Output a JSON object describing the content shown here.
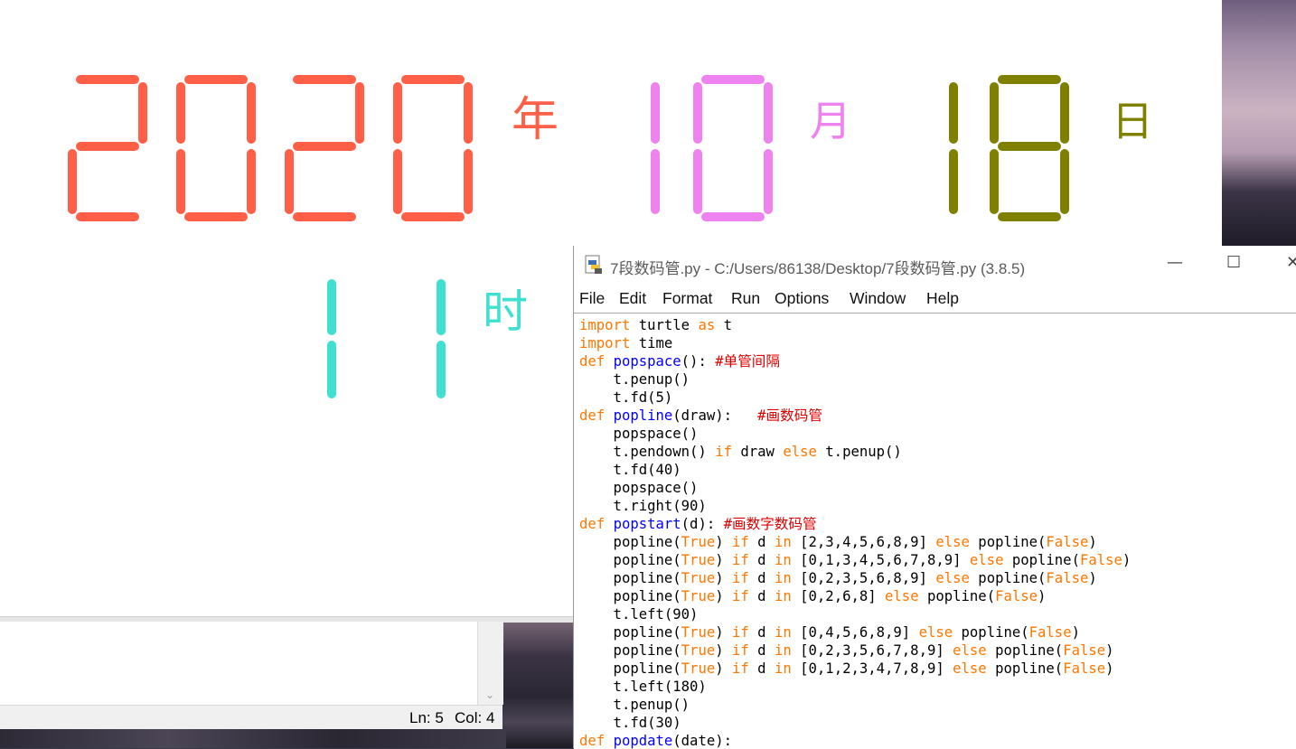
{
  "turtle_display": {
    "year": {
      "digits": "2020",
      "unit": "年",
      "color": "#ff5e47"
    },
    "month": {
      "digits": "10",
      "unit": "月",
      "color": "#ee82ee"
    },
    "day": {
      "digits": "18",
      "unit": "日",
      "color": "#808000"
    },
    "hour": {
      "digits": "11",
      "unit": "时",
      "color": "#40e0d0"
    }
  },
  "editor": {
    "title": "7段数码管.py - C:/Users/86138/Desktop/7段数码管.py (3.8.5)",
    "menu": [
      "File",
      "Edit",
      "Format",
      "Run",
      "Options",
      "Window",
      "Help"
    ],
    "code_lines": [
      [
        {
          "t": "import",
          "c": "kw"
        },
        {
          "t": " turtle "
        },
        {
          "t": "as",
          "c": "kw"
        },
        {
          "t": " t"
        }
      ],
      [
        {
          "t": "import",
          "c": "kw"
        },
        {
          "t": " time"
        }
      ],
      [
        {
          "t": "def",
          "c": "kw"
        },
        {
          "t": " "
        },
        {
          "t": "popspace",
          "c": "fn"
        },
        {
          "t": "(): "
        },
        {
          "t": "#单管间隔",
          "c": "cm"
        }
      ],
      [
        {
          "t": "    t.penup()"
        }
      ],
      [
        {
          "t": "    t.fd(5)"
        }
      ],
      [
        {
          "t": "def",
          "c": "kw"
        },
        {
          "t": " "
        },
        {
          "t": "popline",
          "c": "fn"
        },
        {
          "t": "(draw):   "
        },
        {
          "t": "#画数码管",
          "c": "cm"
        }
      ],
      [
        {
          "t": "    popspace()"
        }
      ],
      [
        {
          "t": "    t.pendown() "
        },
        {
          "t": "if",
          "c": "kw"
        },
        {
          "t": " draw "
        },
        {
          "t": "else",
          "c": "kw"
        },
        {
          "t": " t.penup()"
        }
      ],
      [
        {
          "t": "    t.fd(40)"
        }
      ],
      [
        {
          "t": "    popspace()"
        }
      ],
      [
        {
          "t": "    t.right(90)"
        }
      ],
      [
        {
          "t": "def",
          "c": "kw"
        },
        {
          "t": " "
        },
        {
          "t": "popstart",
          "c": "fn"
        },
        {
          "t": "(d): "
        },
        {
          "t": "#画数字数码管",
          "c": "cm"
        }
      ],
      [
        {
          "t": "    popline("
        },
        {
          "t": "True",
          "c": "kw"
        },
        {
          "t": ") "
        },
        {
          "t": "if",
          "c": "kw"
        },
        {
          "t": " d "
        },
        {
          "t": "in",
          "c": "kw"
        },
        {
          "t": " [2,3,4,5,6,8,9] "
        },
        {
          "t": "else",
          "c": "kw"
        },
        {
          "t": " popline("
        },
        {
          "t": "False",
          "c": "kw"
        },
        {
          "t": ")"
        }
      ],
      [
        {
          "t": "    popline("
        },
        {
          "t": "True",
          "c": "kw"
        },
        {
          "t": ") "
        },
        {
          "t": "if",
          "c": "kw"
        },
        {
          "t": " d "
        },
        {
          "t": "in",
          "c": "kw"
        },
        {
          "t": " [0,1,3,4,5,6,7,8,9] "
        },
        {
          "t": "else",
          "c": "kw"
        },
        {
          "t": " popline("
        },
        {
          "t": "False",
          "c": "kw"
        },
        {
          "t": ")"
        }
      ],
      [
        {
          "t": "    popline("
        },
        {
          "t": "True",
          "c": "kw"
        },
        {
          "t": ") "
        },
        {
          "t": "if",
          "c": "kw"
        },
        {
          "t": " d "
        },
        {
          "t": "in",
          "c": "kw"
        },
        {
          "t": " [0,2,3,5,6,8,9] "
        },
        {
          "t": "else",
          "c": "kw"
        },
        {
          "t": " popline("
        },
        {
          "t": "False",
          "c": "kw"
        },
        {
          "t": ")"
        }
      ],
      [
        {
          "t": "    popline("
        },
        {
          "t": "True",
          "c": "kw"
        },
        {
          "t": ") "
        },
        {
          "t": "if",
          "c": "kw"
        },
        {
          "t": " d "
        },
        {
          "t": "in",
          "c": "kw"
        },
        {
          "t": " [0,2,6,8] "
        },
        {
          "t": "else",
          "c": "kw"
        },
        {
          "t": " popline("
        },
        {
          "t": "False",
          "c": "kw"
        },
        {
          "t": ")"
        }
      ],
      [
        {
          "t": "    t.left(90)"
        }
      ],
      [
        {
          "t": "    popline("
        },
        {
          "t": "True",
          "c": "kw"
        },
        {
          "t": ") "
        },
        {
          "t": "if",
          "c": "kw"
        },
        {
          "t": " d "
        },
        {
          "t": "in",
          "c": "kw"
        },
        {
          "t": " [0,4,5,6,8,9] "
        },
        {
          "t": "else",
          "c": "kw"
        },
        {
          "t": " popline("
        },
        {
          "t": "False",
          "c": "kw"
        },
        {
          "t": ")"
        }
      ],
      [
        {
          "t": "    popline("
        },
        {
          "t": "True",
          "c": "kw"
        },
        {
          "t": ") "
        },
        {
          "t": "if",
          "c": "kw"
        },
        {
          "t": " d "
        },
        {
          "t": "in",
          "c": "kw"
        },
        {
          "t": " [0,2,3,5,6,7,8,9] "
        },
        {
          "t": "else",
          "c": "kw"
        },
        {
          "t": " popline("
        },
        {
          "t": "False",
          "c": "kw"
        },
        {
          "t": ")"
        }
      ],
      [
        {
          "t": "    popline("
        },
        {
          "t": "True",
          "c": "kw"
        },
        {
          "t": ") "
        },
        {
          "t": "if",
          "c": "kw"
        },
        {
          "t": " d "
        },
        {
          "t": "in",
          "c": "kw"
        },
        {
          "t": " [0,1,2,3,4,7,8,9] "
        },
        {
          "t": "else",
          "c": "kw"
        },
        {
          "t": " popline("
        },
        {
          "t": "False",
          "c": "kw"
        },
        {
          "t": ")"
        }
      ],
      [
        {
          "t": "    t.left(180)"
        }
      ],
      [
        {
          "t": "    t.penup()"
        }
      ],
      [
        {
          "t": "    t.fd(30)"
        }
      ],
      [
        {
          "t": "def",
          "c": "kw"
        },
        {
          "t": " "
        },
        {
          "t": "popdate",
          "c": "fn"
        },
        {
          "t": "(date):"
        }
      ]
    ]
  },
  "shell_status": {
    "line": "Ln: 5",
    "col": "Col: 4"
  },
  "window_controls": {
    "minimize": "—",
    "maximize": "☐",
    "close": "✕"
  }
}
